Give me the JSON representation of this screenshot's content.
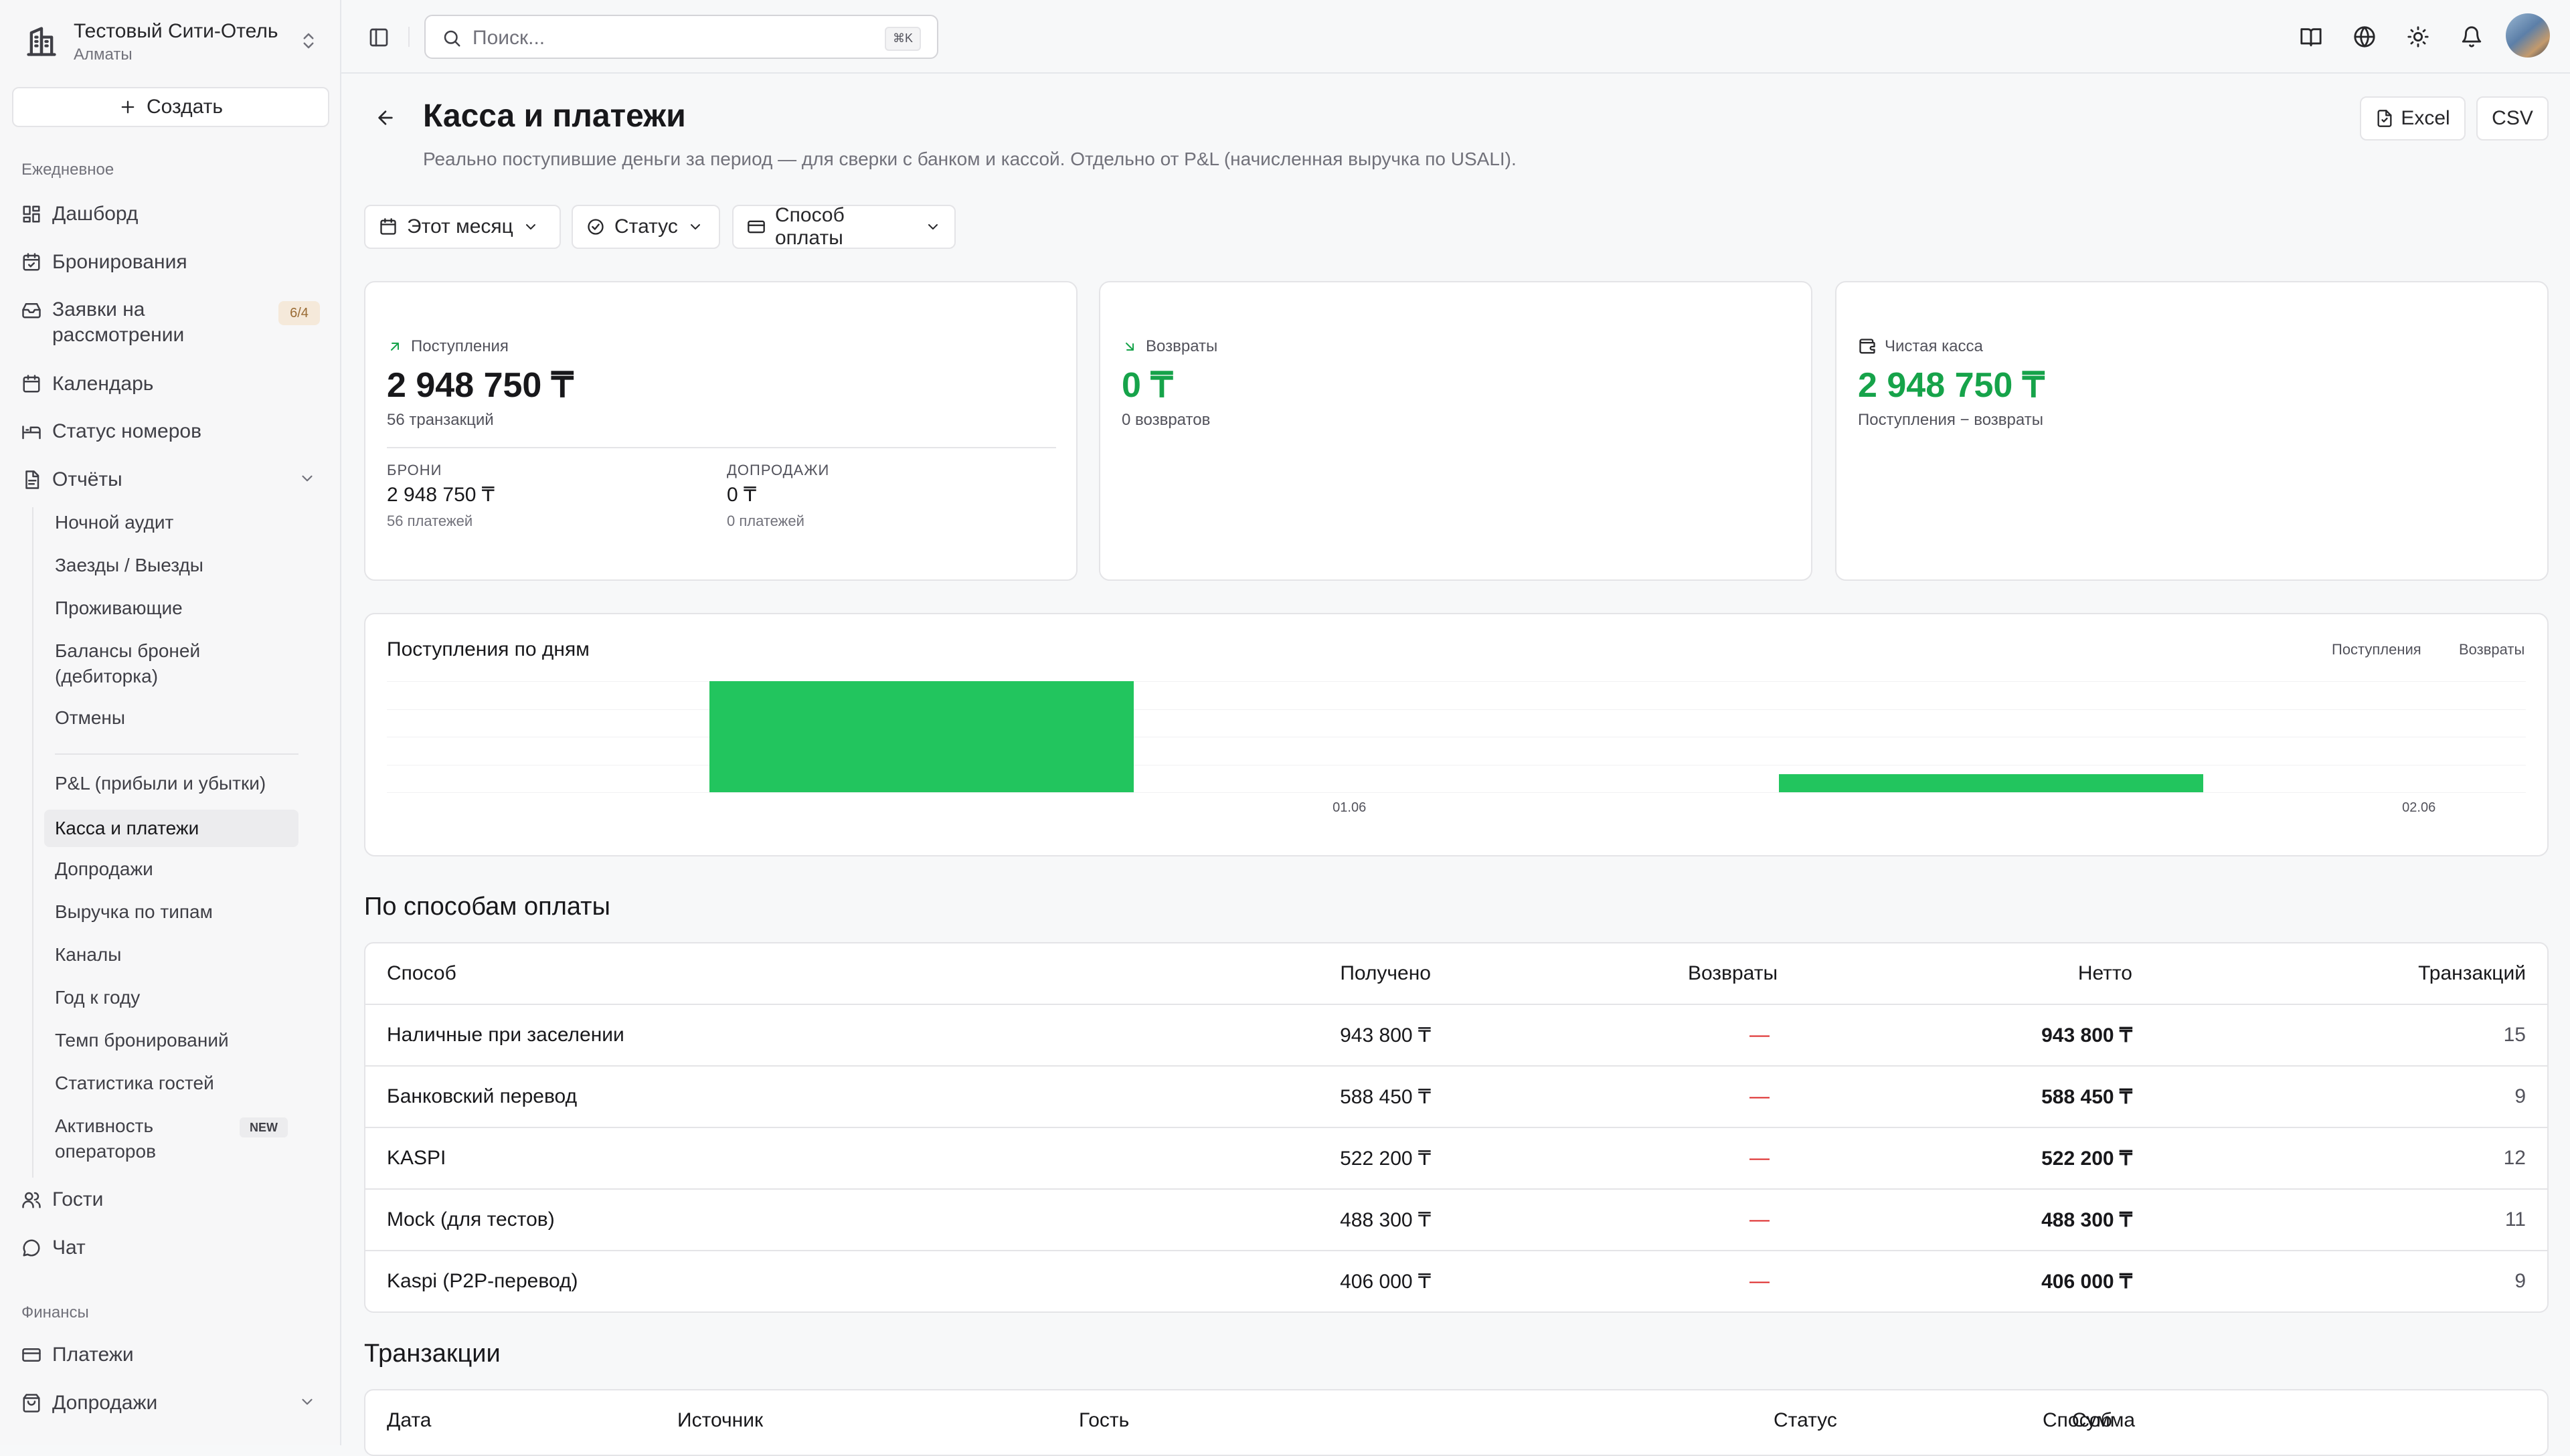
{
  "org": {
    "name": "Тестовый Сити-Отель",
    "city": "Алматы"
  },
  "sidebar": {
    "create_label": "Создать",
    "daily_label": "Ежедневное",
    "items": [
      {
        "label": "Дашборд",
        "icon": "dashboard-icon"
      },
      {
        "label": "Бронирования",
        "icon": "calendar-check-icon"
      },
      {
        "label": "Заявки на рассмотрении",
        "icon": "inbox-icon",
        "badge": "6/4"
      },
      {
        "label": "Календарь",
        "icon": "calendar-icon"
      },
      {
        "label": "Статус номеров",
        "icon": "bed-icon"
      },
      {
        "label": "Отчёты",
        "icon": "report-icon"
      }
    ],
    "report_items": [
      "Ночной аудит",
      "Заезды / Выезды",
      "Проживающие",
      "Балансы броней (дебиторка)",
      "Отмены",
      "P&L (прибыли и убытки)",
      "Касса и платежи",
      "Допродажи",
      "Выручка по типам",
      "Каналы",
      "Год к году",
      "Темп бронирований",
      "Статистика гостей",
      "Активность операторов"
    ],
    "new_badge": "NEW",
    "guests": "Гости",
    "chat": "Чат",
    "finance_label": "Финансы",
    "payments": "Платежи",
    "upsells": "Допродажи"
  },
  "search": {
    "placeholder": "Поиск...",
    "shortcut": "⌘K"
  },
  "page": {
    "title": "Касса и платежи",
    "subtitle": "Реально поступившие деньги за период — для сверки с банком и кассой. Отдельно от P&L (начисленная выручка по USALI).",
    "export_excel": "Excel",
    "export_csv": "CSV"
  },
  "filters": {
    "period": "Этот месяц",
    "status": "Статус",
    "method": "Способ оплаты"
  },
  "cards": {
    "receipts": {
      "label": "Поступления",
      "value": "2 948 750 ₸",
      "note": "56 транзакций",
      "bookings_label": "БРОНИ",
      "bookings_value": "2 948 750 ₸",
      "bookings_count": "56 платежей",
      "upsells_label": "ДОПРОДАЖИ",
      "upsells_value": "0 ₸",
      "upsells_count": "0 платежей"
    },
    "refunds": {
      "label": "Возвраты",
      "value": "0 ₸",
      "note": "0 возвратов"
    },
    "net": {
      "label": "Чистая касса",
      "value": "2 948 750 ₸",
      "note": "Поступления − возвраты"
    }
  },
  "colors": {
    "accent_green": "#16a34a",
    "bar_green": "#22c55e",
    "refund_red": "#dc2626"
  },
  "chart_data": {
    "type": "bar",
    "title": "Поступления по дням",
    "categories": [
      "01.06",
      "02.06"
    ],
    "series": [
      {
        "name": "Поступления",
        "values": [
          2530000,
          418750
        ]
      },
      {
        "name": "Возвраты",
        "values": [
          0,
          0
        ]
      }
    ],
    "ylim": [
      0,
      2530000
    ],
    "legend": "top-right",
    "grid": true
  },
  "methods": {
    "title": "По способам оплаты",
    "columns": [
      "Способ",
      "Получено",
      "Возвраты",
      "Нетто",
      "Транзакций"
    ],
    "rows": [
      {
        "method": "Наличные при заселении",
        "received": "943 800 ₸",
        "refunds": "—",
        "net": "943 800 ₸",
        "count": "15"
      },
      {
        "method": "Банковский перевод",
        "received": "588 450 ₸",
        "refunds": "—",
        "net": "588 450 ₸",
        "count": "9"
      },
      {
        "method": "KASPI",
        "received": "522 200 ₸",
        "refunds": "—",
        "net": "522 200 ₸",
        "count": "12"
      },
      {
        "method": "Mock (для тестов)",
        "received": "488 300 ₸",
        "refunds": "—",
        "net": "488 300 ₸",
        "count": "11"
      },
      {
        "method": "Kaspi (P2P-перевод)",
        "received": "406 000 ₸",
        "refunds": "—",
        "net": "406 000 ₸",
        "count": "9"
      }
    ]
  },
  "transactions": {
    "title": "Транзакции",
    "columns": [
      "Дата",
      "Источник",
      "Гость",
      "Сумма",
      "Статус",
      "Способ"
    ]
  }
}
